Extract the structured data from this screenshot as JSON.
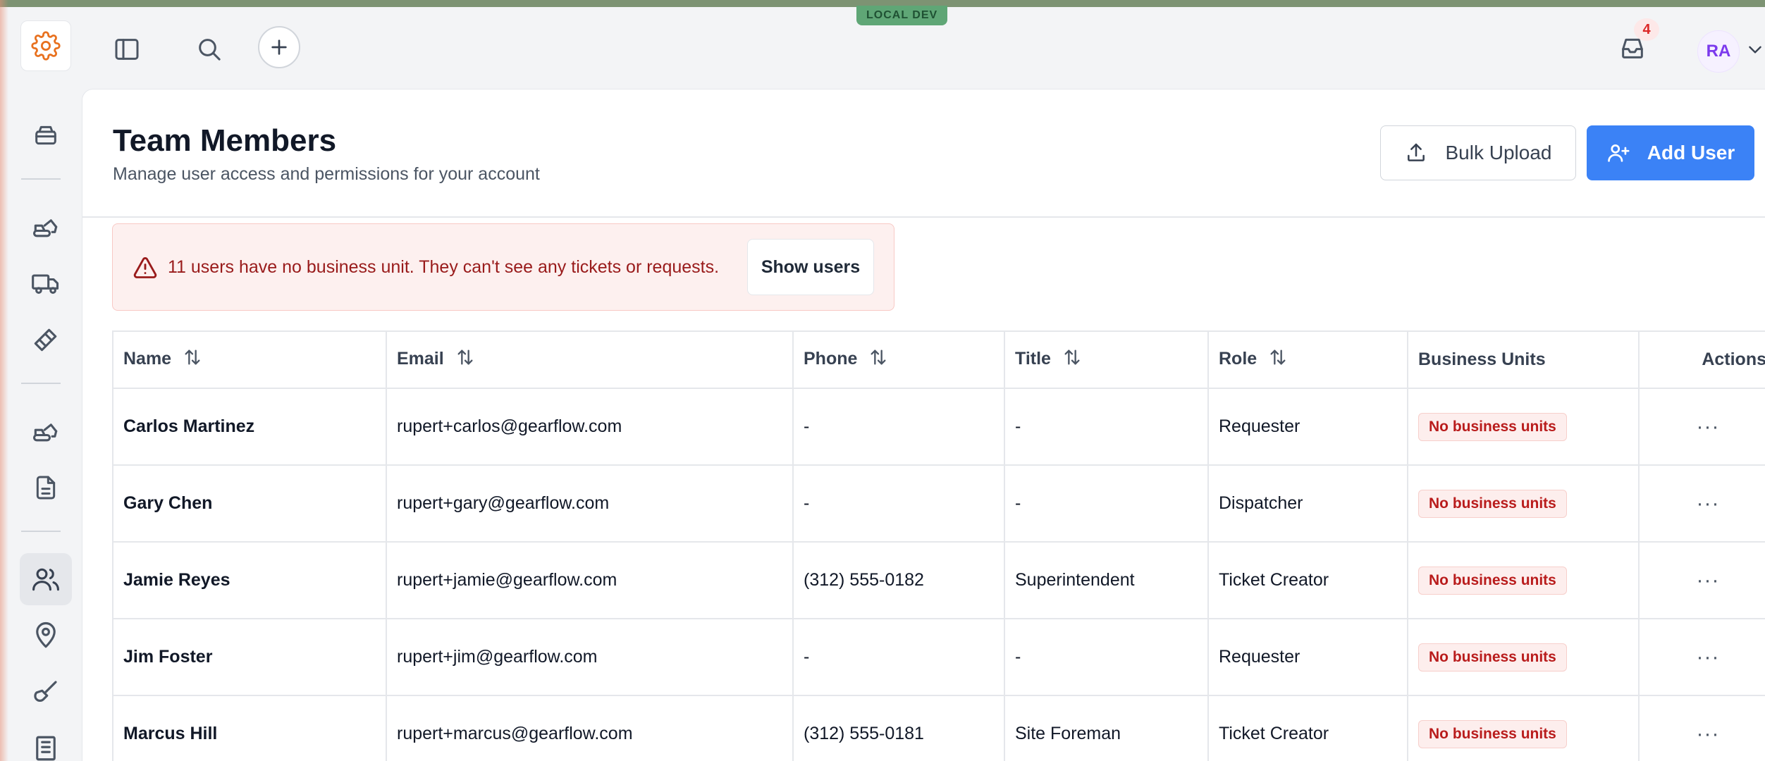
{
  "environment_badge": "LOCAL DEV",
  "topbar": {
    "notification_count": "4",
    "user_initials": "RA"
  },
  "page": {
    "title": "Team Members",
    "subtitle": "Manage user access and permissions for your account"
  },
  "actions": {
    "bulk_upload": "Bulk Upload",
    "add_user": "Add User"
  },
  "alert": {
    "message": "11 users have no business unit. They can't see any tickets or requests.",
    "button": "Show users"
  },
  "table": {
    "headers": {
      "name": "Name",
      "email": "Email",
      "phone": "Phone",
      "title": "Title",
      "role": "Role",
      "business_units": "Business Units",
      "actions": "Actions"
    },
    "rows": [
      {
        "name": "Carlos Martinez",
        "email": "rupert+carlos@gearflow.com",
        "phone": "-",
        "title": "-",
        "role": "Requester",
        "business_units": "No business units",
        "actions": "···"
      },
      {
        "name": "Gary Chen",
        "email": "rupert+gary@gearflow.com",
        "phone": "-",
        "title": "-",
        "role": "Dispatcher",
        "business_units": "No business units",
        "actions": "···"
      },
      {
        "name": "Jamie Reyes",
        "email": "rupert+jamie@gearflow.com",
        "phone": "(312) 555-0182",
        "title": "Superintendent",
        "role": "Ticket Creator",
        "business_units": "No business units",
        "actions": "···"
      },
      {
        "name": "Jim Foster",
        "email": "rupert+jim@gearflow.com",
        "phone": "-",
        "title": "-",
        "role": "Requester",
        "business_units": "No business units",
        "actions": "···"
      },
      {
        "name": "Marcus Hill",
        "email": "rupert+marcus@gearflow.com",
        "phone": "(312) 555-0181",
        "title": "Site Foreman",
        "role": "Ticket Creator",
        "business_units": "No business units",
        "actions": "···"
      }
    ]
  },
  "icons": {
    "logo": "gear-icon",
    "sidebar_toggle": "sidebar-toggle-icon",
    "search": "search-icon",
    "add": "plus-icon",
    "inbox": "inbox-icon",
    "user_menu": "chevron-down-icon",
    "alert": "warning-icon",
    "upload": "upload-icon",
    "add_user": "user-plus-icon",
    "sort": "sort-icon",
    "more": "more-horizontal-icon"
  },
  "colors": {
    "brand_orange": "#e8711f",
    "primary_blue": "#3b82f6",
    "alert_text": "#991b1b",
    "badge_red": "#b91c1c",
    "env_green": "#5fa676"
  }
}
